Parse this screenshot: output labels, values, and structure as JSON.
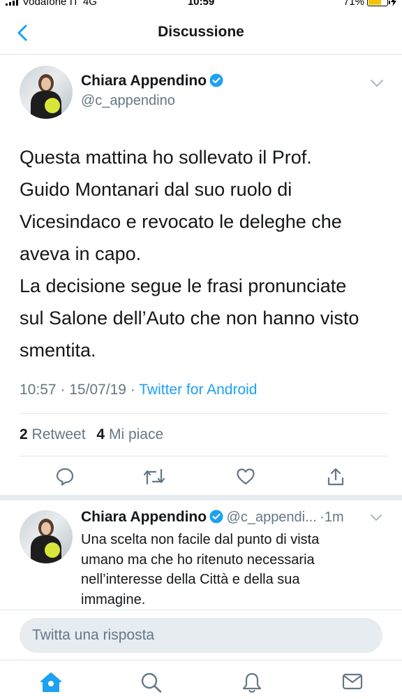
{
  "status_bar": {
    "carrier": "Vodafone IT",
    "network": "4G",
    "time": "10:59",
    "battery": "71%"
  },
  "nav": {
    "title": "Discussione",
    "back_icon": "chevron-left-icon"
  },
  "main_tweet": {
    "author_name": "Chiara Appendino",
    "handle": "@c_appendino",
    "text": "Questa mattina ho sollevato il Prof.\nGuido Montanari dal suo ruolo di\nVicesindaco e revocato le deleghe che\naveva in capo.\nLa decisione segue le frasi pronunciate\nsul Salone dell’Auto che non hanno visto\nsmentita.",
    "timestamp": "10:57 · 15/07/19 · ",
    "source": "Twitter for Android",
    "retweets": "2",
    "retweets_label": "Retweet",
    "likes": "4",
    "likes_label": "Mi piace"
  },
  "reply_tweet": {
    "author_name": "Chiara Appendino",
    "handle": "@c_appendi...",
    "time": "·1m",
    "text": "Una scelta non facile dal punto di vista\numano ma che ho ritenuto necessaria\nnell’interesse della Città e della sua\nimmagine."
  },
  "reply_box": {
    "placeholder": "Twitta una risposta"
  },
  "tabs": [
    {
      "name": "home-icon",
      "active": true
    },
    {
      "name": "search-icon",
      "active": false
    },
    {
      "name": "bell-icon",
      "active": false
    },
    {
      "name": "mail-icon",
      "active": false
    }
  ],
  "colors": {
    "accent": "#1da1f2",
    "secondary_text": "#657786",
    "divider": "#e1e8ed",
    "battery": "#f5c400"
  }
}
